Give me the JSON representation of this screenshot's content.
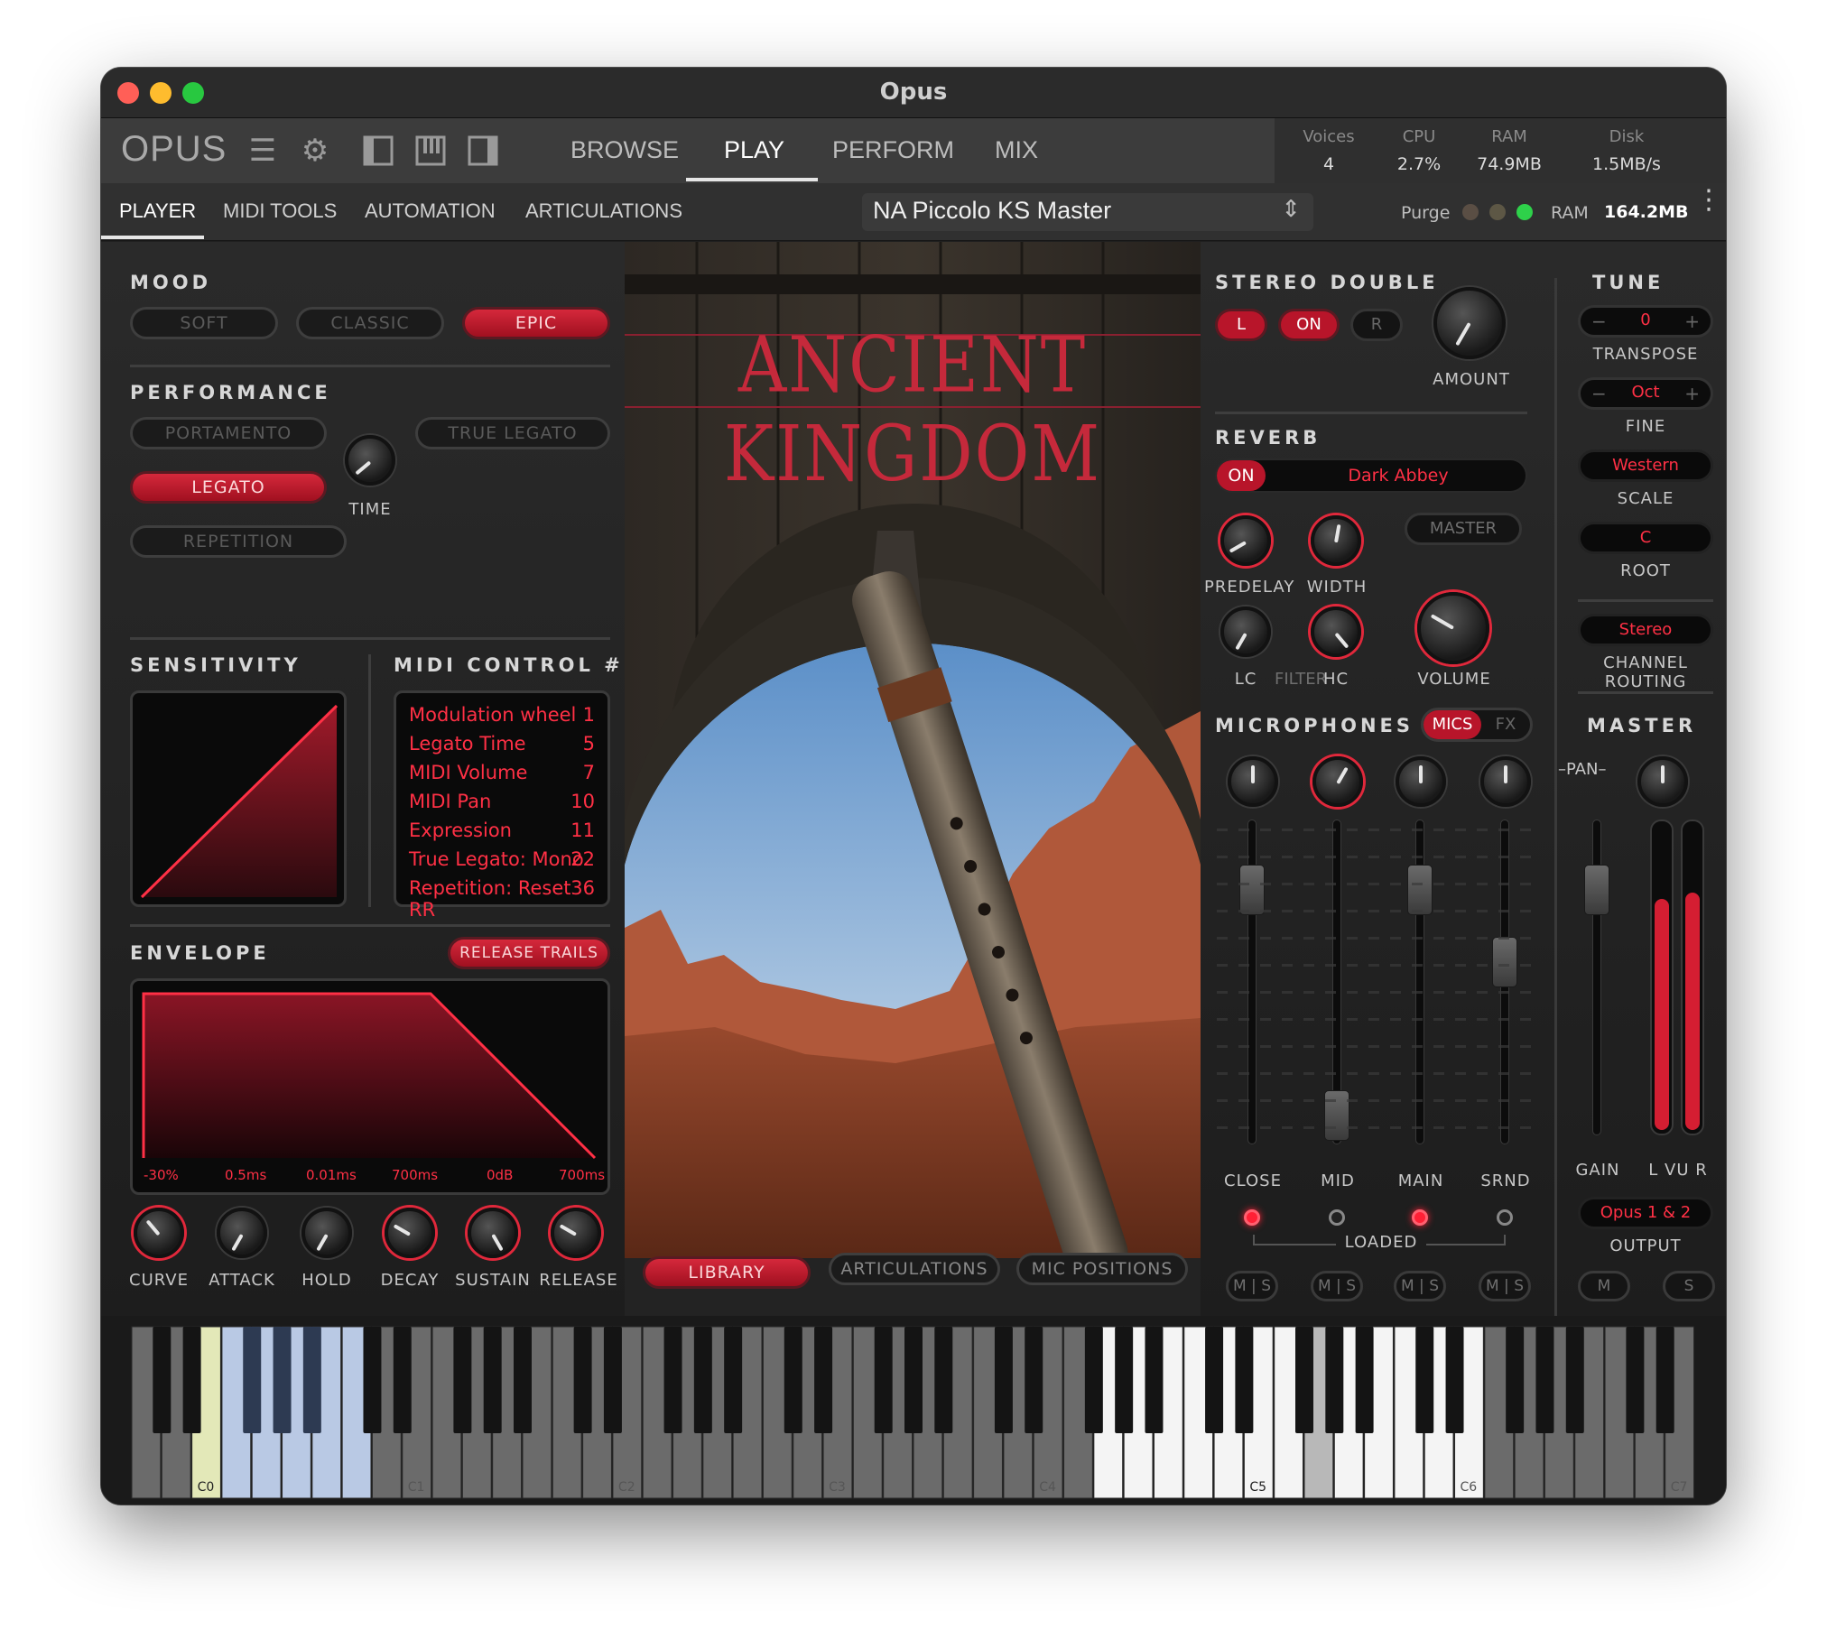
{
  "window": {
    "title": "Opus"
  },
  "topbar": {
    "logo": "OPUS",
    "tabs": [
      "BROWSE",
      "PLAY",
      "PERFORM",
      "MIX"
    ],
    "active_tab": "PLAY",
    "stats": {
      "voices_label": "Voices",
      "voices": "4",
      "cpu_label": "CPU",
      "cpu": "2.7%",
      "ram_label": "RAM",
      "ram": "74.9MB",
      "disk_label": "Disk",
      "disk": "1.5MB/s"
    }
  },
  "subbar": {
    "tabs": [
      "PLAYER",
      "MIDI TOOLS",
      "AUTOMATION",
      "ARTICULATIONS"
    ],
    "active_tab": "PLAYER",
    "preset": "NA Piccolo KS Master",
    "purge_label": "Purge",
    "ram_label": "RAM",
    "ram_value": "164.2MB"
  },
  "mood": {
    "title": "MOOD",
    "options": [
      "SOFT",
      "CLASSIC",
      "EPIC"
    ],
    "selected": "EPIC"
  },
  "performance": {
    "title": "PERFORMANCE",
    "portamento": "PORTAMENTO",
    "true_legato": "TRUE LEGATO",
    "legato": "LEGATO",
    "repetition": "REPETITION",
    "time_label": "TIME"
  },
  "sensitivity": {
    "title": "SENSITIVITY"
  },
  "midi_control": {
    "title": "MIDI CONTROL #",
    "rows": [
      {
        "name": "Modulation wheel",
        "cc": "1"
      },
      {
        "name": "Legato Time",
        "cc": "5"
      },
      {
        "name": "MIDI Volume",
        "cc": "7"
      },
      {
        "name": "MIDI Pan",
        "cc": "10"
      },
      {
        "name": "Expression",
        "cc": "11"
      },
      {
        "name": "True Legato: Mono",
        "cc": "22"
      },
      {
        "name": "Repetition: Reset RR",
        "cc": "36"
      }
    ]
  },
  "envelope": {
    "title": "ENVELOPE",
    "release_trails": "RELEASE TRAILS",
    "values": [
      "-30%",
      "0.5ms",
      "0.01ms",
      "700ms",
      "0dB",
      "700ms"
    ],
    "knobs": [
      "CURVE",
      "ATTACK",
      "HOLD",
      "DECAY",
      "SUSTAIN",
      "RELEASE"
    ]
  },
  "artwork": {
    "title": "ANCIENT KINGDOM"
  },
  "bottom_buttons": {
    "library": "LIBRARY",
    "articulations": "ARTICULATIONS",
    "mic_positions": "MIC POSITIONS"
  },
  "stereo_double": {
    "title": "STEREO DOUBLE",
    "l": "L",
    "on": "ON",
    "r": "R",
    "amount_label": "AMOUNT"
  },
  "reverb": {
    "title": "REVERB",
    "on": "ON",
    "preset": "Dark Abbey",
    "master": "MASTER",
    "predelay": "PREDELAY",
    "width": "WIDTH",
    "lc": "LC",
    "filter": "FILTER",
    "hc": "HC",
    "volume": "VOLUME"
  },
  "microphones": {
    "title": "MICROPHONES",
    "mics": "MICS",
    "fx": "FX",
    "channels": [
      "CLOSE",
      "MID",
      "MAIN",
      "SRND"
    ],
    "loaded_label": "LOADED",
    "m": "M",
    "s": "S",
    "pan_label": "PAN",
    "loaded": [
      true,
      false,
      true,
      false
    ]
  },
  "tune": {
    "title": "TUNE",
    "transpose_value": "0",
    "transpose_label": "TRANSPOSE",
    "fine_value": "Oct",
    "fine_label": "FINE",
    "scale_value": "Western",
    "scale_label": "SCALE",
    "root_value": "C",
    "root_label": "ROOT",
    "routing_value": "Stereo",
    "routing_label": "CHANNEL ROUTING",
    "minus": "−",
    "plus": "+"
  },
  "master": {
    "title": "MASTER",
    "gain_label": "GAIN",
    "vu_label": "L VU R",
    "output_value": "Opus 1 & 2",
    "output_label": "OUTPUT",
    "m": "M",
    "s": "S",
    "vu_levels": [
      0.74,
      0.76
    ]
  },
  "keyboard": {
    "labels": [
      "C0",
      "C1",
      "C2",
      "C3",
      "C4",
      "C5",
      "C6",
      "C7"
    ]
  },
  "colors": {
    "accent": "#e0283b",
    "accent_text": "#ff3045",
    "panel": "#232323"
  }
}
